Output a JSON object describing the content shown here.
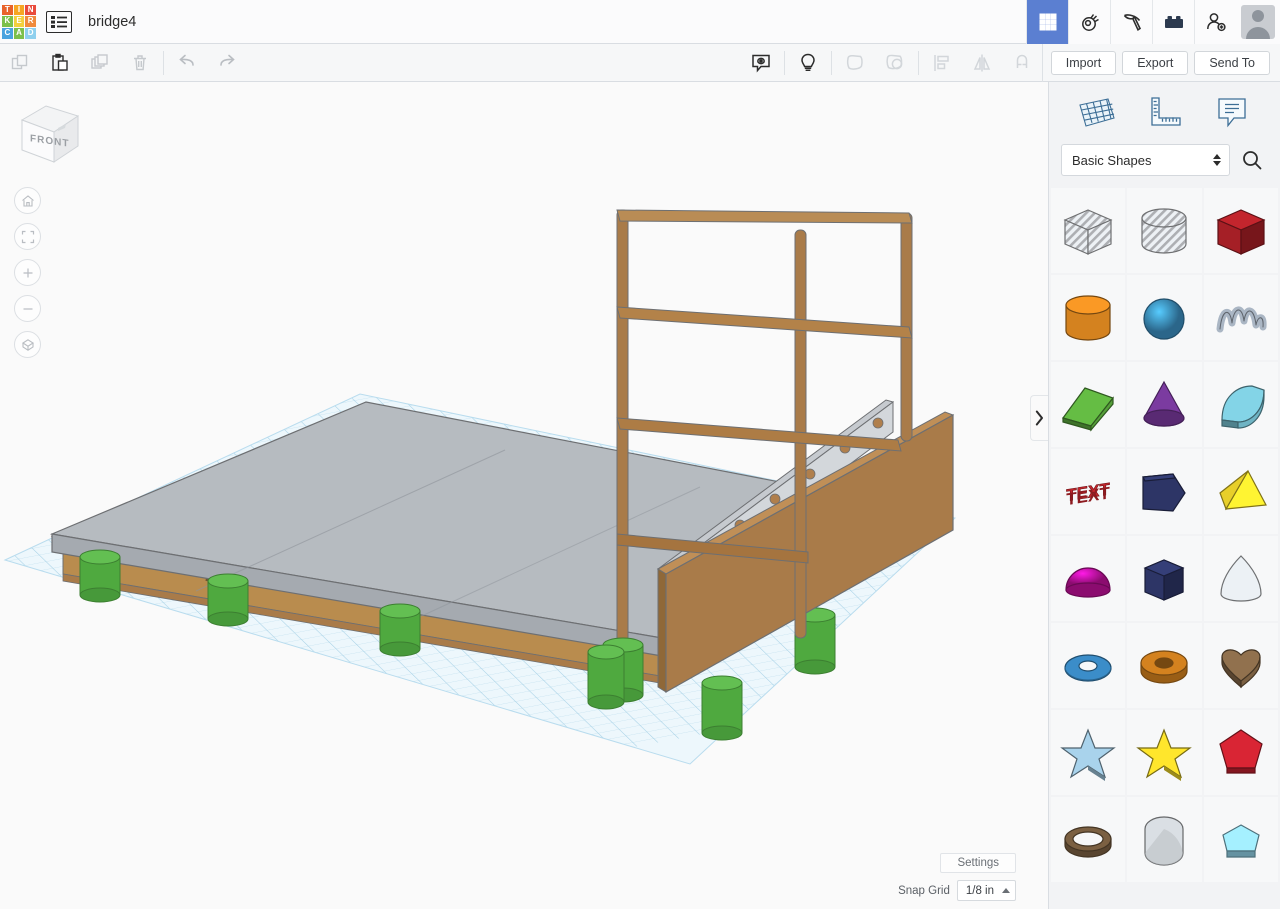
{
  "header": {
    "logo_letters": [
      {
        "ch": "T",
        "color": "#e8622a"
      },
      {
        "ch": "I",
        "color": "#f6a623"
      },
      {
        "ch": "N",
        "color": "#e94b3c"
      },
      {
        "ch": "K",
        "color": "#7cc04b"
      },
      {
        "ch": "E",
        "color": "#f3d03e"
      },
      {
        "ch": "R",
        "color": "#f08a3c"
      },
      {
        "ch": "C",
        "color": "#4aa3df"
      },
      {
        "ch": "A",
        "color": "#7cc04b"
      },
      {
        "ch": "D",
        "color": "#8fd0ee"
      }
    ],
    "menu_icon": "list-icon",
    "doc_title": "bridge4",
    "right_icons": [
      {
        "name": "grid-gallery-icon",
        "active": true
      },
      {
        "name": "codeblocks-icon",
        "active": false
      },
      {
        "name": "minecraft-pickaxe-icon",
        "active": false
      },
      {
        "name": "lego-brick-icon",
        "active": false
      },
      {
        "name": "invite-person-icon",
        "active": false
      }
    ],
    "avatar_label": "avatar"
  },
  "toolbar": {
    "left_items": [
      {
        "name": "copy-button",
        "enabled": false
      },
      {
        "name": "paste-button",
        "enabled": true
      },
      {
        "name": "duplicate-button",
        "enabled": false
      },
      {
        "name": "delete-button",
        "enabled": false
      }
    ],
    "history_items": [
      {
        "name": "undo-button",
        "enabled": true
      },
      {
        "name": "redo-button",
        "enabled": true
      }
    ],
    "right_items": [
      {
        "name": "note-button",
        "enabled": true
      },
      {
        "name": "light-button",
        "enabled": true
      },
      {
        "name": "group-button",
        "enabled": false
      },
      {
        "name": "ungroup-button",
        "enabled": false
      },
      {
        "name": "align-button",
        "enabled": false
      },
      {
        "name": "mirror-button",
        "enabled": false
      },
      {
        "name": "magnet-button",
        "enabled": false
      }
    ],
    "import_label": "Import",
    "export_label": "Export",
    "send_to_label": "Send To"
  },
  "canvas": {
    "viewcube_face": "FRONT",
    "nav_buttons": [
      {
        "name": "home-view-button",
        "icon": "home-icon"
      },
      {
        "name": "fit-to-view-button",
        "icon": "fit-frame-icon"
      },
      {
        "name": "zoom-in-button",
        "icon": "plus-icon"
      },
      {
        "name": "zoom-out-button",
        "icon": "minus-icon"
      },
      {
        "name": "perspective-toggle-button",
        "icon": "cube-perspective-icon"
      }
    ],
    "settings_label": "Settings",
    "snap_grid_label": "Snap Grid",
    "snap_grid_value": "1/8 in",
    "workplane_color": "#ddeef7",
    "model": {
      "deck_color": "#b6bbc0",
      "beam_color": "#c49a5e",
      "rail_color": "#a97b49",
      "pillar_color": "#4fa93f"
    }
  },
  "panel": {
    "tools": [
      {
        "name": "workplane-tool",
        "icon": "workplane-grid-icon"
      },
      {
        "name": "ruler-tool",
        "icon": "ruler-icon"
      },
      {
        "name": "notes-tool",
        "icon": "note-bubble-icon"
      }
    ],
    "category_value": "Basic Shapes",
    "search_icon": "search-icon",
    "collapse_icon": "chevron-right-icon",
    "shapes": [
      {
        "name": "box-hole",
        "label": "Box (hole)",
        "color": "#c9ccd0",
        "kind": "cube",
        "hatch": true
      },
      {
        "name": "cylinder-hole",
        "label": "Cylinder (hole)",
        "color": "#c9ccd0",
        "kind": "cylinder",
        "hatch": true
      },
      {
        "name": "box-solid",
        "label": "Box",
        "color": "#a51f26",
        "kind": "cube",
        "hatch": false
      },
      {
        "name": "cylinder-solid",
        "label": "Cylinder",
        "color": "#d4821f",
        "kind": "cylinder",
        "hatch": false
      },
      {
        "name": "sphere",
        "label": "Sphere",
        "color": "#3c8dc0",
        "kind": "sphere",
        "hatch": false
      },
      {
        "name": "scribble",
        "label": "Scribble",
        "color": "#aab6c4",
        "kind": "scribble",
        "hatch": false
      },
      {
        "name": "wedge",
        "label": "Wedge",
        "color": "#56a03a",
        "kind": "wedge",
        "hatch": false
      },
      {
        "name": "cone",
        "label": "Cone",
        "color": "#7b3ba0",
        "kind": "cone",
        "hatch": false
      },
      {
        "name": "roof-round",
        "label": "Round Roof",
        "color": "#6fb4c4",
        "kind": "roof",
        "hatch": false
      },
      {
        "name": "text",
        "label": "Text",
        "color": "#c4252c",
        "kind": "text",
        "hatch": false
      },
      {
        "name": "arrow-block",
        "label": "Arrow",
        "color": "#2d3566",
        "kind": "arrow",
        "hatch": false
      },
      {
        "name": "pyramid",
        "label": "Pyramid",
        "color": "#e8cf2a",
        "kind": "pyramid",
        "hatch": false
      },
      {
        "name": "half-sphere",
        "label": "Half Sphere",
        "color": "#c1119a",
        "kind": "half",
        "hatch": false
      },
      {
        "name": "hex-prism",
        "label": "Hexagonal Prism",
        "color": "#2d3566",
        "kind": "hex",
        "hatch": false
      },
      {
        "name": "paraboloid",
        "label": "Paraboloid",
        "color": "#c8ccd0",
        "kind": "parab",
        "hatch": false
      },
      {
        "name": "torus-blue",
        "label": "Torus",
        "color": "#3b8dc9",
        "kind": "torus",
        "hatch": false
      },
      {
        "name": "tube-orange",
        "label": "Tube",
        "color": "#d4821f",
        "kind": "tube",
        "hatch": false
      },
      {
        "name": "heart",
        "label": "Heart",
        "color": "#7b6042",
        "kind": "heart",
        "hatch": false
      },
      {
        "name": "star-blue",
        "label": "Star",
        "color": "#8fb3c8",
        "kind": "star",
        "hatch": false
      },
      {
        "name": "star-yellow",
        "label": "Star",
        "color": "#d8c325",
        "kind": "star",
        "hatch": false
      },
      {
        "name": "polygon-red",
        "label": "Polygon",
        "color": "#b81f2c",
        "kind": "poly",
        "hatch": false
      },
      {
        "name": "ring-brown",
        "label": "Ring",
        "color": "#7b6042",
        "kind": "ring",
        "hatch": false
      },
      {
        "name": "rounded-cylinder",
        "label": "Rounded Cylinder",
        "color": "#b9bdc1",
        "kind": "roundcyl",
        "hatch": false
      },
      {
        "name": "polygon-blue",
        "label": "Polygon",
        "color": "#8ccbe0",
        "kind": "polyflat",
        "hatch": false
      }
    ]
  }
}
